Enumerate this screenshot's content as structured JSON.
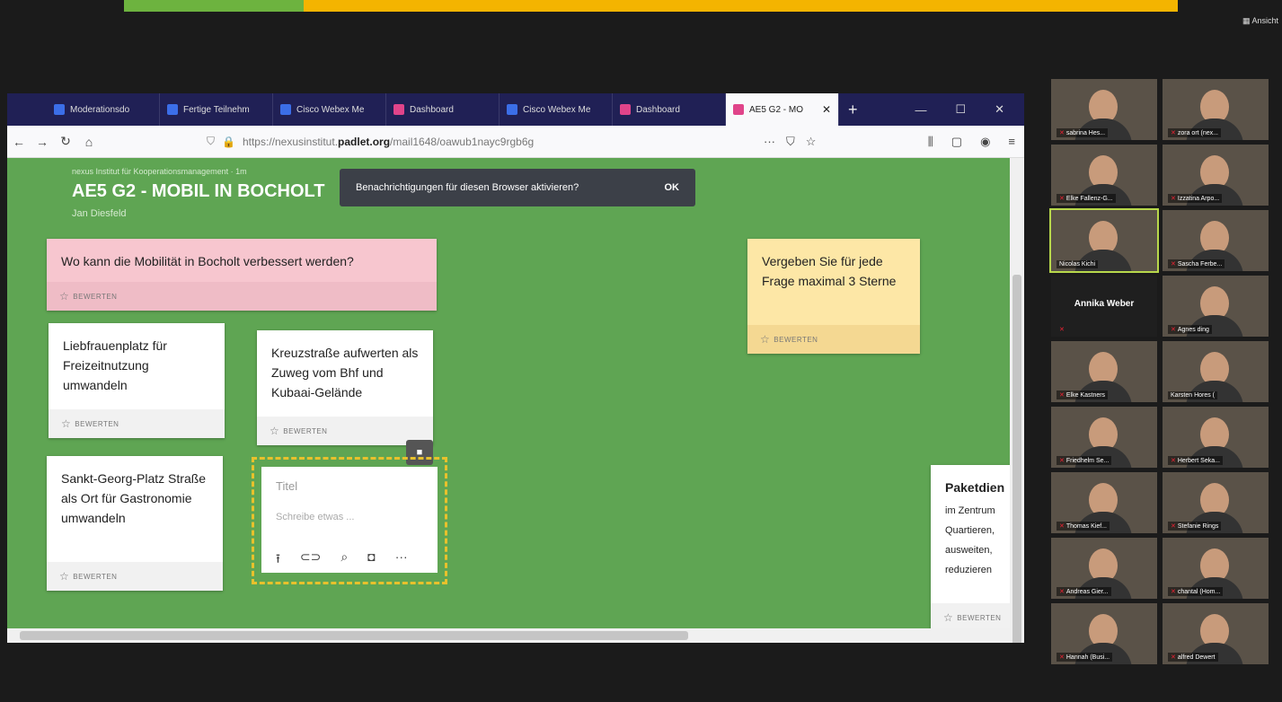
{
  "view_button": "Ansicht",
  "browser": {
    "tabs": [
      {
        "label": "Moderationsdo",
        "color": "#3b6ee8"
      },
      {
        "label": "Fertige Teilnehm",
        "color": "#3b6ee8"
      },
      {
        "label": "Cisco Webex Me",
        "color": "#3b6ee8"
      },
      {
        "label": "Dashboard",
        "color": "#e0448a"
      },
      {
        "label": "Cisco Webex Me",
        "color": "#3b6ee8"
      },
      {
        "label": "Dashboard",
        "color": "#e0448a"
      },
      {
        "label": "AE5 G2 - MO",
        "color": "#e0448a",
        "active": true
      }
    ],
    "url_prefix": "https://nexusinstitut.",
    "url_domain": "padlet.org",
    "url_path": "/mail1648/oawub1nayc9rgb6g"
  },
  "padlet": {
    "meta": "nexus Institut für Kooperationsmanagement · 1m",
    "title": "AE5 G2 - MOBIL IN BOCHOLT",
    "author": "Jan Diesfeld",
    "toast": "Benachrichtigungen für diesen Browser aktivieren?",
    "toast_ok": "OK",
    "rate_label": "BEWERTEN",
    "cards": [
      {
        "text": "Wo kann die Mobilität in Bocholt verbessert werden?"
      },
      {
        "text": "Vergeben Sie für jede Frage maximal 3 Sterne"
      },
      {
        "text": "Liebfrauenplatz für Freizeitnutzung umwandeln"
      },
      {
        "text": "Kreuzstraße aufwerten als Zuweg vom Bhf und Kubaai-Gelände"
      },
      {
        "text": "Sankt-Georg-Platz Straße als Ort für Gastronomie umwandeln"
      },
      {
        "title": "Paketdien",
        "text": "im Zentrum Quartieren, ausweiten, reduzieren"
      }
    ],
    "editor": {
      "title_placeholder": "Titel",
      "body_placeholder": "Schreibe etwas ..."
    }
  },
  "participants": [
    "sabrina Hes...",
    "zora ort (nex...",
    "Elke Fallenz-G...",
    "Izzatina Arpo...",
    "Nicolas Kichi",
    "Sascha Ferbe...",
    "Annika Weber",
    "Agnes ding",
    "Elke Kastners",
    "Karsten Hores (",
    "Friedhelm Se...",
    "Herbert Seka...",
    "Thomas Kief...",
    "Stefanie Rings",
    "Andreas Gier...",
    "chantal (Hom...",
    "Hannah (Busi...",
    "alfred Dewert"
  ]
}
